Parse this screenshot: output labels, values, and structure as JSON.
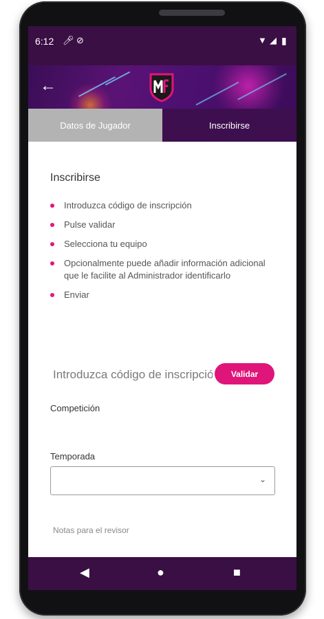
{
  "status_bar": {
    "time": "6:12"
  },
  "tabs": [
    {
      "label": "Datos de Jugador",
      "active": false
    },
    {
      "label": "Inscribirse",
      "active": true
    }
  ],
  "section": {
    "title": "Inscribirse",
    "steps": [
      "Introduzca código de inscripción",
      "Pulse validar",
      "Selecciona tu equipo",
      "Opcionalmente puede añadir información adicional que le facilite al Administrador identificarlo",
      "Enviar"
    ]
  },
  "form": {
    "code_placeholder": "Introduzca código de inscripción",
    "validate_label": "Validar",
    "competition_label": "Competición",
    "season_label": "Temporada",
    "notes_label": "Notas para el revisor"
  },
  "colors": {
    "accent": "#e0157a",
    "bar": "#3a0f44",
    "tab_active": "#3e0f4e",
    "tab_inactive": "#b3b3b3"
  },
  "icons": [
    "back-arrow-icon",
    "app-logo",
    "mic-icon",
    "sync-icon",
    "wifi-icon",
    "signal-icon",
    "battery-icon",
    "chevron-down-icon",
    "nav-back-icon",
    "nav-home-icon",
    "nav-recents-icon"
  ]
}
